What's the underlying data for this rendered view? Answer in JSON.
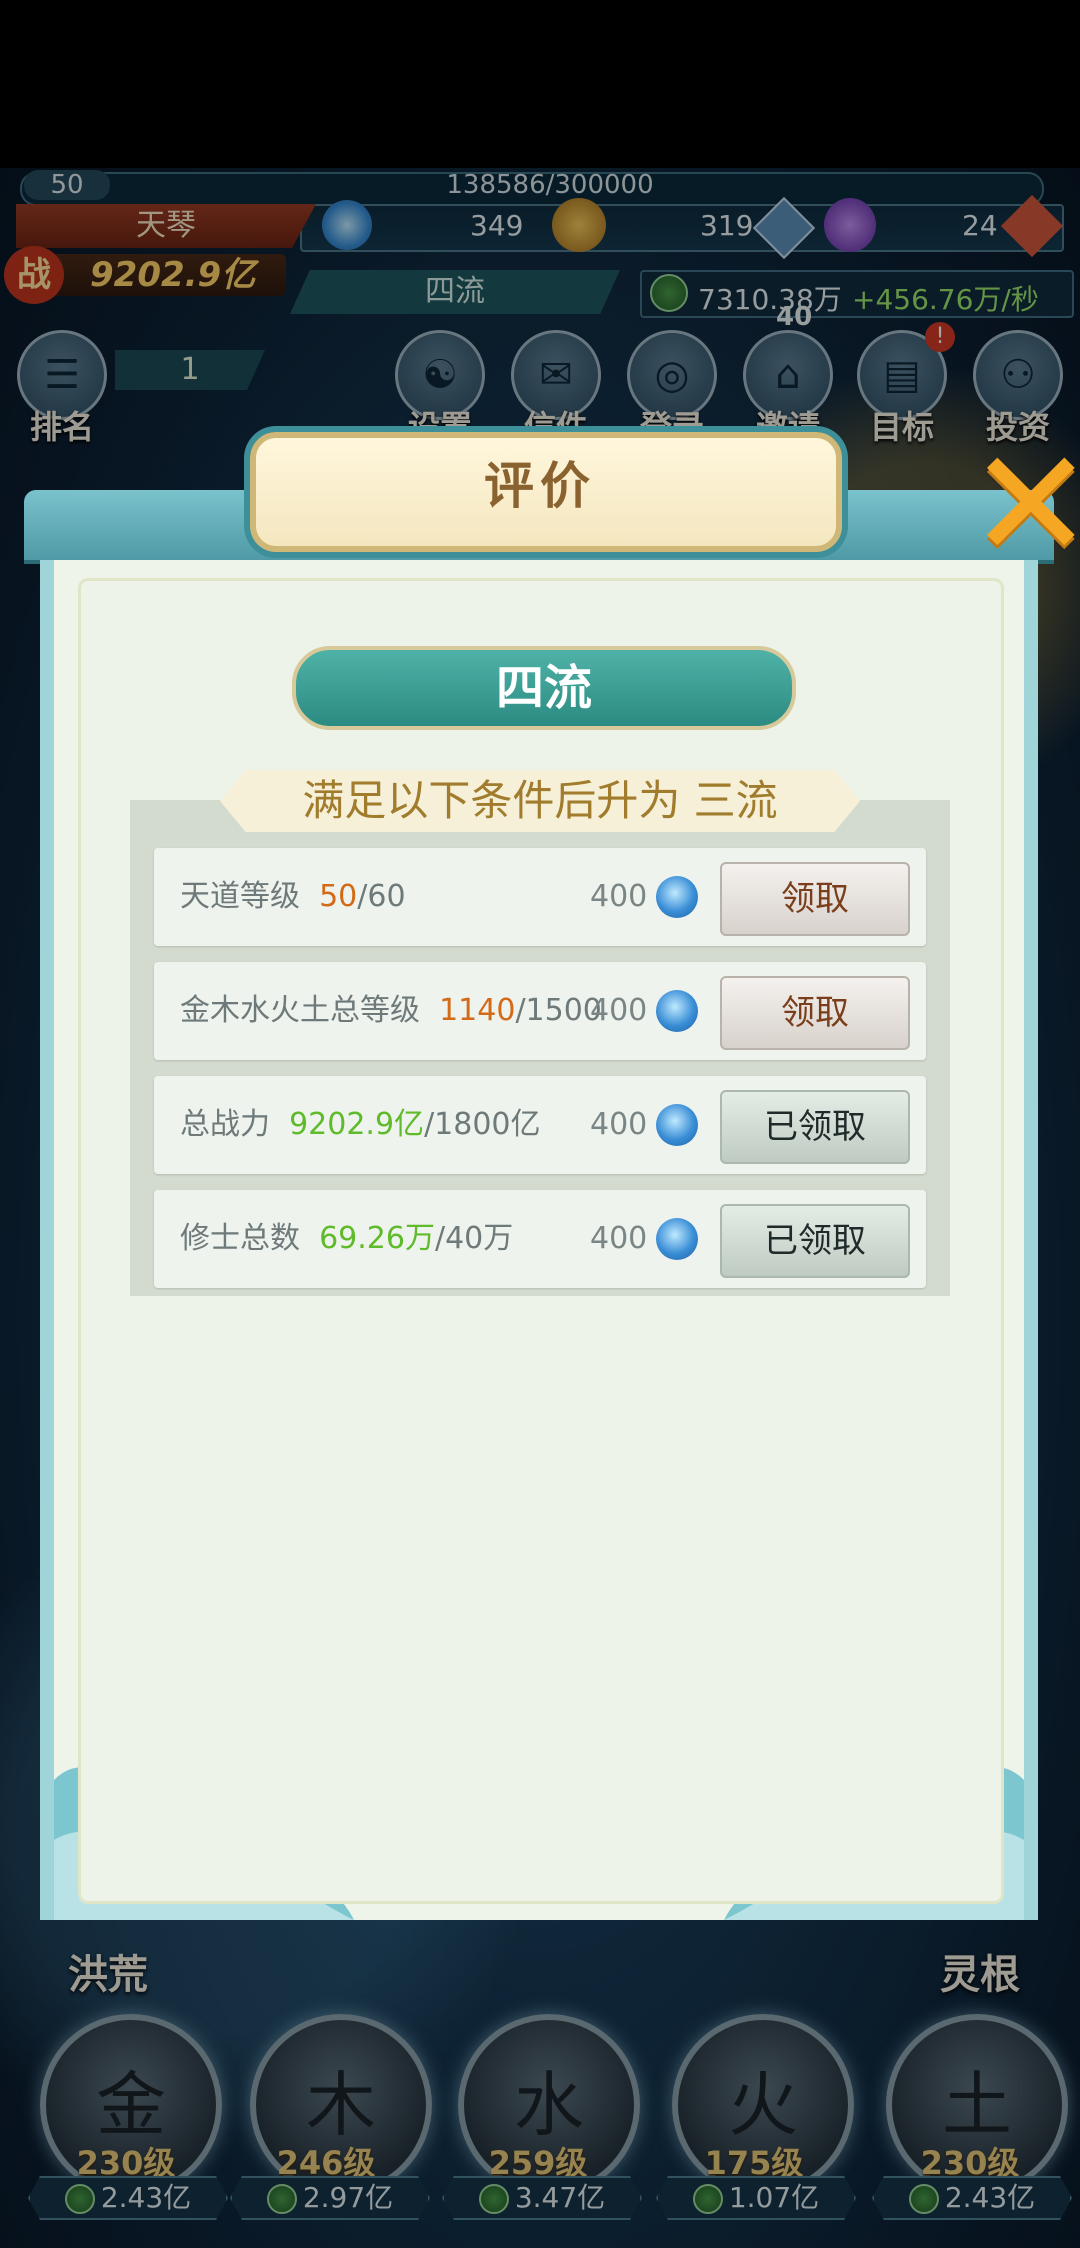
{
  "header": {
    "level": "50",
    "exp": "138586/300000",
    "player_name": "天琴",
    "res1": "349",
    "res2": "319",
    "res3": "24",
    "power_label": "战",
    "power": "9202.9亿",
    "rank_title": "四流",
    "gold": "7310.38万",
    "gold_rate": "+456.76万/秒",
    "badge_40": "40"
  },
  "top_menu": {
    "rank_label": "排名",
    "rank_value": "1",
    "items": [
      {
        "label": "设置",
        "icon": "settings-icon"
      },
      {
        "label": "信件",
        "icon": "mail-icon"
      },
      {
        "label": "登录",
        "icon": "login-icon"
      },
      {
        "label": "邀请",
        "icon": "invite-icon"
      },
      {
        "label": "目标",
        "icon": "goal-icon",
        "badge": "!"
      },
      {
        "label": "投资",
        "icon": "invest-icon"
      }
    ]
  },
  "dialog": {
    "title": "评价",
    "current_rank": "四流",
    "condition_title": "满足以下条件后升为 三流",
    "rows": [
      {
        "label": "天道等级",
        "current": "50",
        "target": "/60",
        "reward": "400",
        "button": "领取",
        "state": "claim"
      },
      {
        "label": "金木水火土总等级",
        "current": "1140",
        "target": "/1500",
        "reward": "400",
        "button": "领取",
        "state": "claim"
      },
      {
        "label": "总战力",
        "current": "9202.9亿",
        "target": "/1800亿",
        "reward": "400",
        "button": "已领取",
        "state": "done"
      },
      {
        "label": "修士总数",
        "current": "69.26万",
        "target": "/40万",
        "reward": "400",
        "button": "已领取",
        "state": "done"
      }
    ]
  },
  "bottom": {
    "left_label": "洪荒",
    "right_label": "灵根",
    "elements": [
      {
        "glyph": "金",
        "level": "230级",
        "cost": "2.43亿"
      },
      {
        "glyph": "木",
        "level": "246级",
        "cost": "2.97亿"
      },
      {
        "glyph": "水",
        "level": "259级",
        "cost": "3.47亿"
      },
      {
        "glyph": "火",
        "level": "175级",
        "cost": "1.07亿"
      },
      {
        "glyph": "土",
        "level": "230级",
        "cost": "2.43亿"
      }
    ]
  }
}
